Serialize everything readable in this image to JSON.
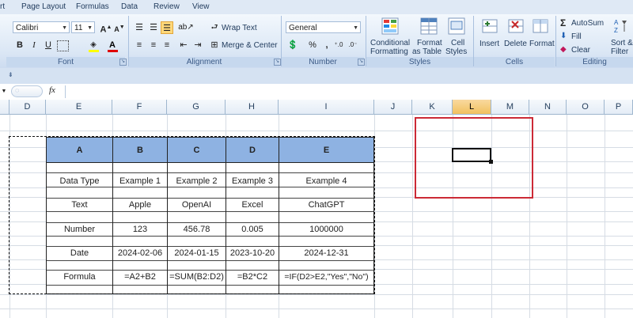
{
  "menu": [
    "rt",
    "Page Layout",
    "Formulas",
    "Data",
    "Review",
    "View"
  ],
  "font": {
    "name": "Calibri",
    "size": "11",
    "group_label": "Font"
  },
  "alignment": {
    "wrap_text": "Wrap Text",
    "merge_center": "Merge & Center",
    "group_label": "Alignment"
  },
  "number": {
    "format": "General",
    "group_label": "Number",
    "percent": "%",
    "comma": ","
  },
  "styles": {
    "conditional_l1": "Conditional",
    "conditional_l2": "Formatting",
    "format_table_l1": "Format",
    "format_table_l2": "as Table",
    "cell_styles_l1": "Cell",
    "cell_styles_l2": "Styles",
    "group_label": "Styles"
  },
  "cells": {
    "insert": "Insert",
    "delete": "Delete",
    "format": "Format",
    "group_label": "Cells"
  },
  "editing": {
    "autosum": "AutoSum",
    "fill": "Fill",
    "clear": "Clear",
    "sort_l1": "Sort &",
    "sort_l2": "Filter",
    "group_label": "Editing"
  },
  "formula_bar": {
    "fx": "fx",
    "content": ""
  },
  "columns": [
    "D",
    "E",
    "F",
    "G",
    "H",
    "I",
    "J",
    "K",
    "L",
    "M",
    "N",
    "O",
    "P"
  ],
  "active_column": "L",
  "table": {
    "headers": [
      "A",
      "B",
      "C",
      "D",
      "E"
    ],
    "rows": [
      [
        "Data Type",
        "Example 1",
        "Example 2",
        "Example 3",
        "Example 4"
      ],
      [
        "Text",
        "Apple",
        "OpenAI",
        "Excel",
        "ChatGPT"
      ],
      [
        "Number",
        "123",
        "456.78",
        "0.005",
        "1000000"
      ],
      [
        "Date",
        "2024-02-06",
        "2024-01-15",
        "2023-10-20",
        "2024-12-31"
      ],
      [
        "Formula",
        "=A2+B2",
        "=SUM(B2:D2)",
        "=B2*C2",
        "=IF(D2>E2,\"Yes\",\"No\")"
      ]
    ]
  },
  "colors": {
    "table_header": "#8eb2e2",
    "annotation_box": "#cc2a36",
    "ribbon": "#dbe7f5"
  }
}
